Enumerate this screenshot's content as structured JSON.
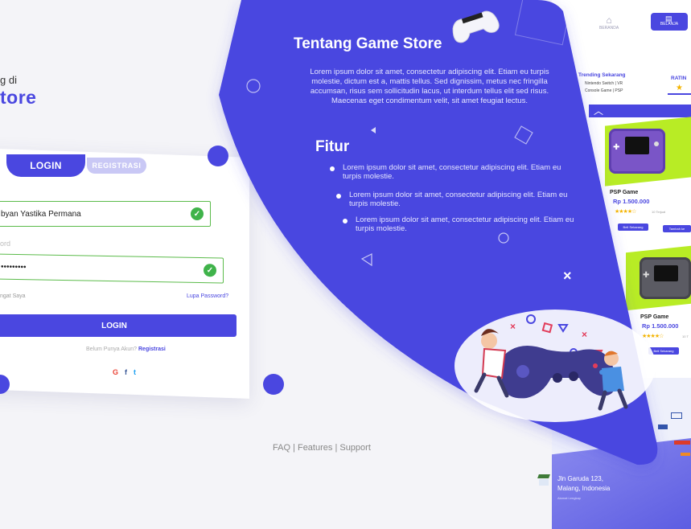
{
  "login": {
    "brand_prefix": "g di",
    "brand_name": "tore",
    "tab_login": "LOGIN",
    "tab_register": "REGISTRASI",
    "username_value": "byan Yastika Permana",
    "password_label": "ord",
    "password_value": "•••••••••",
    "remember_label": "ngat Saya",
    "forgot_label": "Lupa Password?",
    "submit_label": "LOGIN",
    "no_account_text": "Belum Punya Akun?",
    "register_link": "Registrasi",
    "social": [
      "G",
      "f",
      "t"
    ],
    "footer_links": "FAQ | Features | Support"
  },
  "about": {
    "title": "Tentang Game Store",
    "body": "Lorem ipsum dolor sit amet, consectetur adipiscing elit. Etiam eu turpis molestie, dictum est a, mattis tellus. Sed dignissim, metus nec fringilla accumsan, risus sem sollicitudin lacus, ut interdum tellus elit sed risus. Maecenas eget condimentum velit, sit amet feugiat lectus.",
    "features_title": "Fitur",
    "features": [
      "Lorem ipsum dolor sit amet, consectetur adipiscing elit. Etiam eu turpis molestie.",
      "Lorem ipsum dolor sit amet, consectetur adipiscing elit. Etiam eu turpis molestie.",
      "Lorem ipsum dolor sit amet, consectetur adipiscing elit. Etiam eu turpis molestie."
    ]
  },
  "store": {
    "nav_home": "BERANDA",
    "nav_cart": "BELANJA",
    "trending_title": "Trending Sekarang",
    "rating_title": "RATIN",
    "trending_line1": "Nintendo Switch  |  VR",
    "trending_line2": "Console Game  |  PSP",
    "products": [
      {
        "name": "PSP Game",
        "price": "Rp 1.500.000",
        "stars": "★★★★☆",
        "reviews": "10 Terjual",
        "buy": "Beli Sekarang",
        "cart": "Tambah ke"
      },
      {
        "name": "PSP Game",
        "price": "Rp 1.500.000",
        "stars": "★★★★☆",
        "reviews": "10 T",
        "buy": "Beli Sekarang",
        "cart": ""
      }
    ],
    "address_line1": "Jln Garuda 123,",
    "address_line2": "Malang, Indonesia",
    "address_small": "Alamat Lengkap"
  },
  "colors": {
    "accent": "#4a47e0",
    "success": "#3fb34a",
    "soft_purple": "#c9c8f5"
  }
}
